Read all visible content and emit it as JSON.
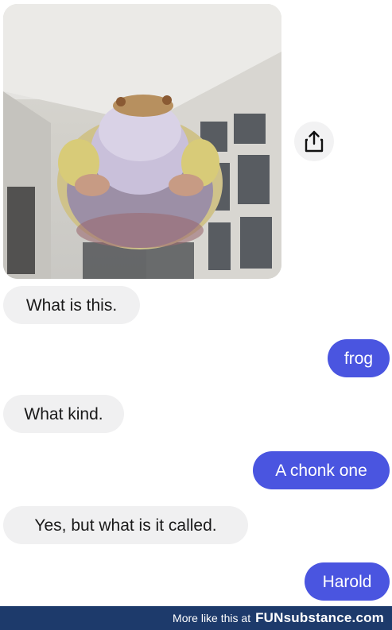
{
  "conversation": {
    "shared_image": {
      "icon": "share-icon"
    },
    "messages": [
      {
        "direction": "incoming",
        "text": "What is this."
      },
      {
        "direction": "outgoing",
        "text": "frog"
      },
      {
        "direction": "incoming",
        "text": "What kind."
      },
      {
        "direction": "outgoing",
        "text": "A chonk one"
      },
      {
        "direction": "incoming",
        "text": "Yes, but what is it called."
      },
      {
        "direction": "outgoing",
        "text": "Harold"
      }
    ],
    "colors": {
      "incoming_bubble": "#f0f0f1",
      "outgoing_bubble": "#4a55e0",
      "footer_bar": "#1d3a6b"
    }
  },
  "footer": {
    "lead_text": "More like this at",
    "brand": "FUNsubstance.com"
  }
}
